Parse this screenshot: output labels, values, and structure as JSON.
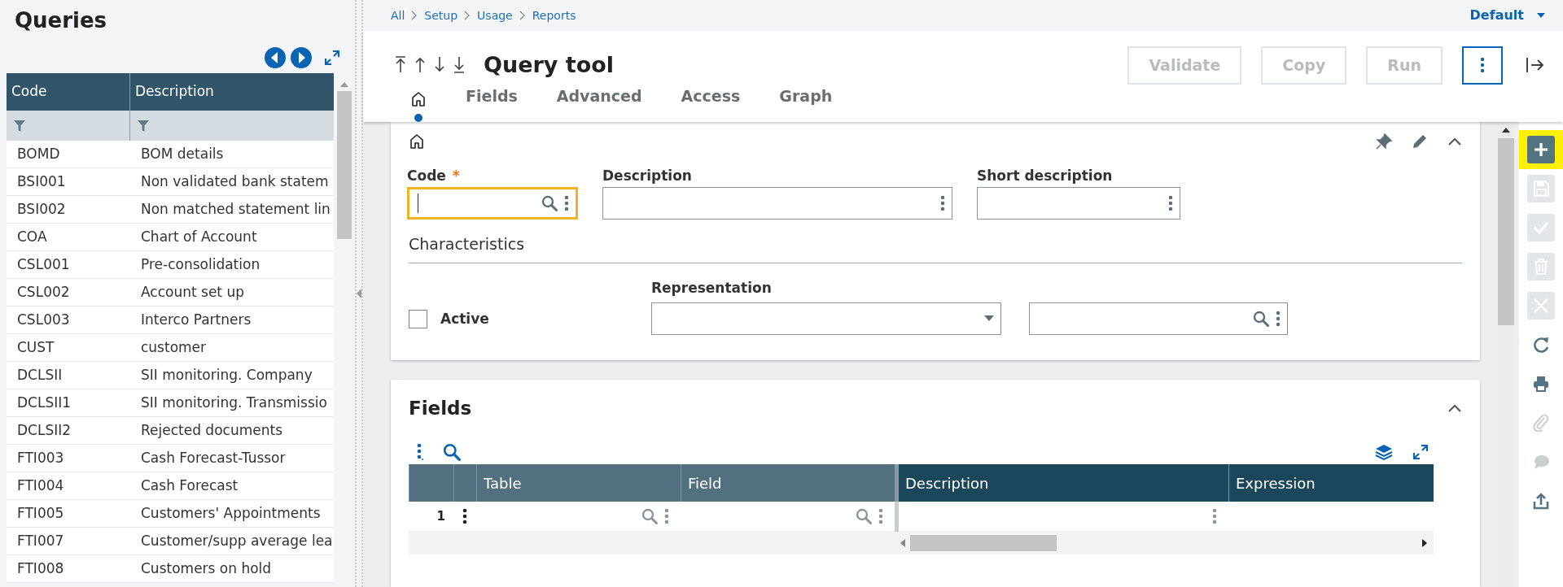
{
  "left_panel": {
    "title": "Queries",
    "table": {
      "columns": [
        "Code",
        "Description"
      ],
      "rows": [
        {
          "code": "BOMD",
          "description": "BOM details"
        },
        {
          "code": "BSI001",
          "description": "Non validated bank statem"
        },
        {
          "code": "BSI002",
          "description": "Non matched statement lin"
        },
        {
          "code": "COA",
          "description": "Chart of Account"
        },
        {
          "code": "CSL001",
          "description": "Pre-consolidation"
        },
        {
          "code": "CSL002",
          "description": "Account set up"
        },
        {
          "code": "CSL003",
          "description": "Interco Partners"
        },
        {
          "code": "CUST",
          "description": "customer"
        },
        {
          "code": "DCLSII",
          "description": "SII monitoring. Company"
        },
        {
          "code": "DCLSII1",
          "description": "SII monitoring. Transmissio"
        },
        {
          "code": "DCLSII2",
          "description": "Rejected documents"
        },
        {
          "code": "FTI003",
          "description": "Cash Forecast-Tussor"
        },
        {
          "code": "FTI004",
          "description": "Cash Forecast"
        },
        {
          "code": "FTI005",
          "description": "Customers' Appointments"
        },
        {
          "code": "FTI007",
          "description": "Customer/supp average lea"
        },
        {
          "code": "FTI008",
          "description": "Customers on hold"
        }
      ]
    }
  },
  "breadcrumb": [
    "All",
    "Setup",
    "Usage",
    "Reports"
  ],
  "view_selector": {
    "value": "Default"
  },
  "header": {
    "title": "Query tool",
    "buttons": [
      {
        "label": "Validate",
        "disabled": true
      },
      {
        "label": "Copy",
        "disabled": true
      },
      {
        "label": "Run",
        "disabled": true
      }
    ]
  },
  "tabs": [
    {
      "kind": "home",
      "selected": true
    },
    {
      "kind": "text",
      "label": "Fields",
      "selected": false
    },
    {
      "kind": "text",
      "label": "Advanced",
      "selected": false
    },
    {
      "kind": "text",
      "label": "Access",
      "selected": false
    },
    {
      "kind": "text",
      "label": "Graph",
      "selected": false
    }
  ],
  "main_section": {
    "fields": [
      {
        "label": "Code",
        "required_mark": "*",
        "focused": true,
        "lookup": true
      },
      {
        "label": "Description",
        "focused": false,
        "lookup": false
      },
      {
        "label": "Short description",
        "focused": false,
        "lookup": false
      }
    ],
    "characteristics": {
      "title": "Characteristics",
      "active": {
        "label": "Active",
        "checked": false
      },
      "representation": {
        "label": "Representation"
      }
    }
  },
  "fields_section": {
    "title": "Fields",
    "grid": {
      "columns": [
        {
          "label": "Table",
          "frozen": true
        },
        {
          "label": "Field",
          "frozen": true
        },
        {
          "label": "Description",
          "frozen": false
        },
        {
          "label": "Expression",
          "frozen": false
        }
      ],
      "rows": [
        {
          "number": "1"
        }
      ]
    }
  },
  "toolbar": [
    {
      "kind": "new",
      "disabled": false,
      "highlighted": true
    },
    {
      "kind": "save",
      "disabled": true,
      "highlighted": false
    },
    {
      "kind": "validate",
      "disabled": true,
      "highlighted": false
    },
    {
      "kind": "delete",
      "disabled": true,
      "highlighted": false
    },
    {
      "kind": "cancel",
      "disabled": true,
      "highlighted": false
    },
    {
      "kind": "refresh",
      "disabled": false,
      "highlighted": false
    },
    {
      "kind": "print",
      "disabled": false,
      "highlighted": false
    },
    {
      "kind": "attach",
      "disabled": true,
      "highlighted": false
    },
    {
      "kind": "comment",
      "disabled": true,
      "highlighted": false
    },
    {
      "kind": "export",
      "disabled": false,
      "highlighted": false
    }
  ]
}
